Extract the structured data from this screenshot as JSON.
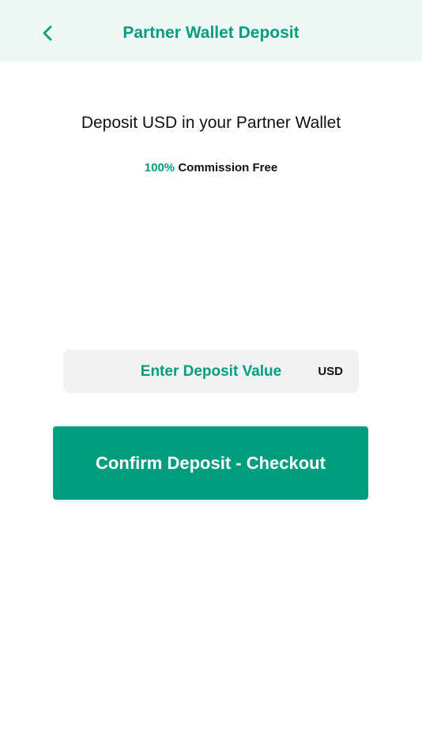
{
  "header": {
    "title": "Partner Wallet Deposit",
    "back_icon": "chevron-left-icon"
  },
  "main": {
    "heading": "Deposit USD in your Partner Wallet",
    "commission_percent": "100%",
    "commission_text": "Commission Free",
    "deposit_input": {
      "value": "",
      "placeholder": "Enter Deposit Value",
      "currency": "USD"
    },
    "confirm_label": "Confirm Deposit - Checkout"
  },
  "colors": {
    "accent": "#009E7E",
    "header_bg": "#F0F8F6",
    "input_bg": "#F2F2F4",
    "text": "#111111"
  }
}
